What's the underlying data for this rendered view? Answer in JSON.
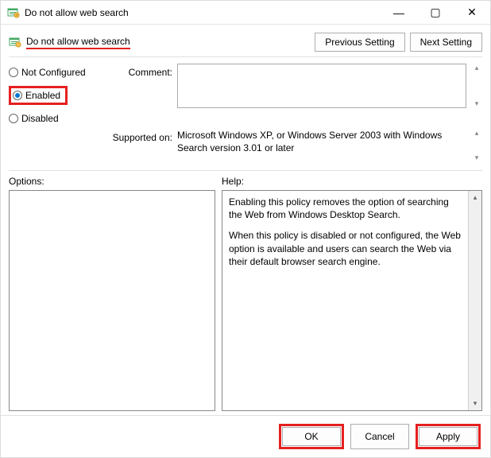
{
  "window": {
    "title": "Do not allow web search",
    "controls": {
      "min": "—",
      "max": "▢",
      "close": "✕"
    }
  },
  "header": {
    "title": "Do not allow web search",
    "prev": "Previous Setting",
    "next": "Next Setting"
  },
  "state": {
    "not_configured": "Not Configured",
    "enabled": "Enabled",
    "disabled": "Disabled",
    "selected": "enabled"
  },
  "comment": {
    "label": "Comment:",
    "value": ""
  },
  "supported": {
    "label": "Supported on:",
    "text": "Microsoft Windows XP, or Windows Server 2003 with Windows Search version 3.01 or later"
  },
  "panes": {
    "options_label": "Options:",
    "help_label": "Help:",
    "help_p1": "Enabling this policy removes the option of searching the Web from Windows Desktop Search.",
    "help_p2": "When this policy is disabled or not configured, the Web option is available and users can search the Web via their default browser search engine."
  },
  "footer": {
    "ok": "OK",
    "cancel": "Cancel",
    "apply": "Apply"
  },
  "glyphs": {
    "up": "▴",
    "down": "▾"
  }
}
